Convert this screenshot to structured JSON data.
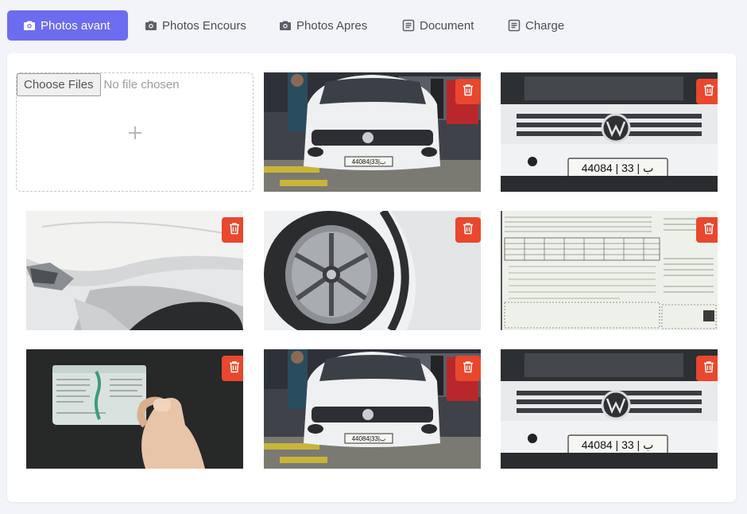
{
  "tabs": [
    {
      "label": "Photos avant",
      "icon": "camera-icon",
      "active": true
    },
    {
      "label": "Photos Encours",
      "icon": "camera-icon",
      "active": false
    },
    {
      "label": "Photos Apres",
      "icon": "camera-icon",
      "active": false
    },
    {
      "label": "Document",
      "icon": "document-icon",
      "active": false
    },
    {
      "label": "Charge",
      "icon": "document-icon",
      "active": false
    }
  ],
  "upload": {
    "button_label": "Choose Files",
    "status_text": "No file chosen",
    "icon": "plus-icon"
  },
  "photos": [
    {
      "subject": "white-suv-front"
    },
    {
      "subject": "suv-grille-plate"
    },
    {
      "subject": "damaged-fender"
    },
    {
      "subject": "wheel-rim"
    },
    {
      "subject": "registration-document"
    },
    {
      "subject": "id-card-in-hand"
    },
    {
      "subject": "white-suv-front"
    },
    {
      "subject": "suv-grille-plate"
    }
  ],
  "colors": {
    "accent": "#6c6cf0",
    "delete": "#e9472e",
    "background": "#f3f4f9"
  },
  "delete_icon": "trash-icon"
}
